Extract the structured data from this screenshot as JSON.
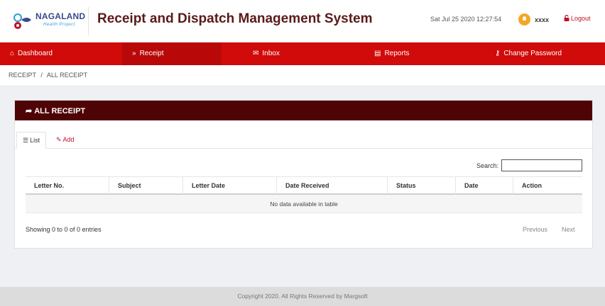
{
  "header": {
    "logo_text": "NAGALAND",
    "logo_subtext": "Health Project",
    "app_title": "Receipt and Dispatch Management System",
    "datetime": "Sat Jul 25 2020 12:27:54",
    "username": "xxxx",
    "logout_label": "Logout",
    "colors": {
      "title": "#5a1a1a",
      "logout": "#c0102a",
      "avatar": "#f5a623"
    }
  },
  "nav": {
    "background": "#d10a0a",
    "items": [
      {
        "label": "Dashboard",
        "icon": "home-icon"
      },
      {
        "label": "Receipt",
        "icon": "double-chevron-down-icon",
        "active": true
      },
      {
        "label": "Inbox",
        "icon": "envelope-icon"
      },
      {
        "label": "Reports",
        "icon": "document-icon"
      },
      {
        "label": "Change Password",
        "icon": "key-icon"
      }
    ]
  },
  "breadcrumb": {
    "items": [
      "RECEIPT",
      "ALL RECEIPT"
    ],
    "separator": "/"
  },
  "panel": {
    "title": "ALL RECEIPT",
    "header_color": "#4e0404",
    "tabs": [
      {
        "label": "List",
        "icon": "list-icon",
        "active": true
      },
      {
        "label": "Add",
        "icon": "edit-icon"
      }
    ],
    "search_label": "Search:",
    "search_value": "",
    "table": {
      "columns": [
        "Letter No.",
        "Subject",
        "Letter Date",
        "Date Received",
        "Status",
        "Date",
        "Action"
      ],
      "empty_message": "No data available in table"
    },
    "info_text": "Showing 0 to 0 of 0 entries",
    "pagination": {
      "previous": "Previous",
      "next": "Next"
    }
  },
  "footer": {
    "text": "Copyright 2020. All Rights Reserved by Margsoft"
  }
}
